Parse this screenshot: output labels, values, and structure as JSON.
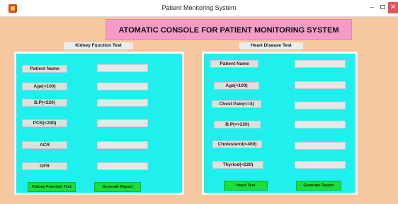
{
  "window": {
    "title": "Patient Monitoring System",
    "minimize_glyph": "–",
    "close_glyph": "✕"
  },
  "banner": {
    "text": "ATOMATIC CONSOLE FOR PATIENT MONITORING SYSTEM"
  },
  "kidney": {
    "title": "Kidney Function Test",
    "fields": [
      {
        "label": "Patient Name",
        "value": ""
      },
      {
        "label": "Age(<100)",
        "value": ""
      },
      {
        "label": "B.P(<220)",
        "value": ""
      },
      {
        "label": "PCR(<200)",
        "value": ""
      },
      {
        "label": "ACR",
        "value": ""
      },
      {
        "label": "GFR",
        "value": ""
      }
    ],
    "test_button": "Kidney Function Test",
    "report_button": "Generate Report"
  },
  "heart": {
    "title": "Heart Disease Test",
    "fields": [
      {
        "label": "Patient Name",
        "value": ""
      },
      {
        "label": "Age(<100)",
        "value": ""
      },
      {
        "label": "Chest Pain(<=4)",
        "value": ""
      },
      {
        "label": "B.P(<=220)",
        "value": ""
      },
      {
        "label": "Cholesterol(<400)",
        "value": ""
      },
      {
        "label": "Thyriod(<220)",
        "value": ""
      }
    ],
    "test_button": "Heart Test",
    "report_button": "Generate Report"
  },
  "colors": {
    "background": "#f6c89f",
    "panel": "#1fefed",
    "banner": "#f49cc7",
    "button": "#1ddc3b",
    "close_button": "#e3535a"
  }
}
